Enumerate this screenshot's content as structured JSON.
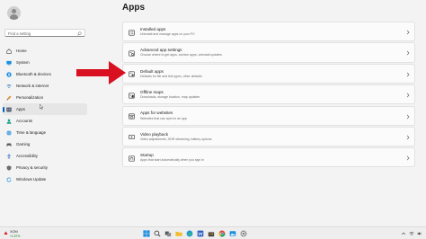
{
  "profile": {
    "name": "",
    "email": ""
  },
  "search": {
    "placeholder": "Find a setting"
  },
  "sidebar": {
    "items": [
      {
        "label": "Home",
        "icon": "home-icon",
        "active": false
      },
      {
        "label": "System",
        "icon": "system-icon",
        "active": false
      },
      {
        "label": "Bluetooth & devices",
        "icon": "bluetooth-icon",
        "active": false
      },
      {
        "label": "Network & internet",
        "icon": "network-icon",
        "active": false
      },
      {
        "label": "Personalization",
        "icon": "brush-icon",
        "active": false
      },
      {
        "label": "Apps",
        "icon": "apps-icon",
        "active": true
      },
      {
        "label": "Accounts",
        "icon": "accounts-icon",
        "active": false
      },
      {
        "label": "Time & language",
        "icon": "globe-icon",
        "active": false
      },
      {
        "label": "Gaming",
        "icon": "gaming-icon",
        "active": false
      },
      {
        "label": "Accessibility",
        "icon": "accessibility-icon",
        "active": false
      },
      {
        "label": "Privacy & security",
        "icon": "shield-icon",
        "active": false
      },
      {
        "label": "Windows Update",
        "icon": "update-icon",
        "active": false
      }
    ]
  },
  "main": {
    "title": "Apps",
    "cards": [
      {
        "title": "Installed apps",
        "description": "Uninstall and manage apps on your PC",
        "icon": "installed-apps-icon"
      },
      {
        "title": "Advanced app settings",
        "description": "Choose where to get apps, archive apps, uninstall updates",
        "icon": "advanced-app-settings-icon"
      },
      {
        "title": "Default apps",
        "description": "Defaults for file and link types, other defaults",
        "icon": "default-apps-icon"
      },
      {
        "title": "Offline maps",
        "description": "Downloads, storage location, map updates",
        "icon": "offline-maps-icon"
      },
      {
        "title": "Apps for websites",
        "description": "Websites that can open in an app",
        "icon": "apps-for-websites-icon"
      },
      {
        "title": "Video playback",
        "description": "Video adjustments, HDR streaming, battery options",
        "icon": "video-playback-icon"
      },
      {
        "title": "Startup",
        "description": "Apps that start automatically when you sign in",
        "icon": "startup-icon"
      }
    ]
  },
  "taskbar": {
    "ticker": {
      "name": "XOM",
      "change": "+1.57%"
    },
    "pinned": [
      "start-icon",
      "search-icon",
      "task-view-icon",
      "file-explorer-icon",
      "edge-icon",
      "word-icon",
      "store-icon",
      "chrome-icon",
      "photos-icon",
      "settings-icon"
    ]
  },
  "colors": {
    "accent": "#005fb8",
    "arrow": "#d8101f",
    "background": "#f3f3f3",
    "card": "#fbfbfb"
  }
}
